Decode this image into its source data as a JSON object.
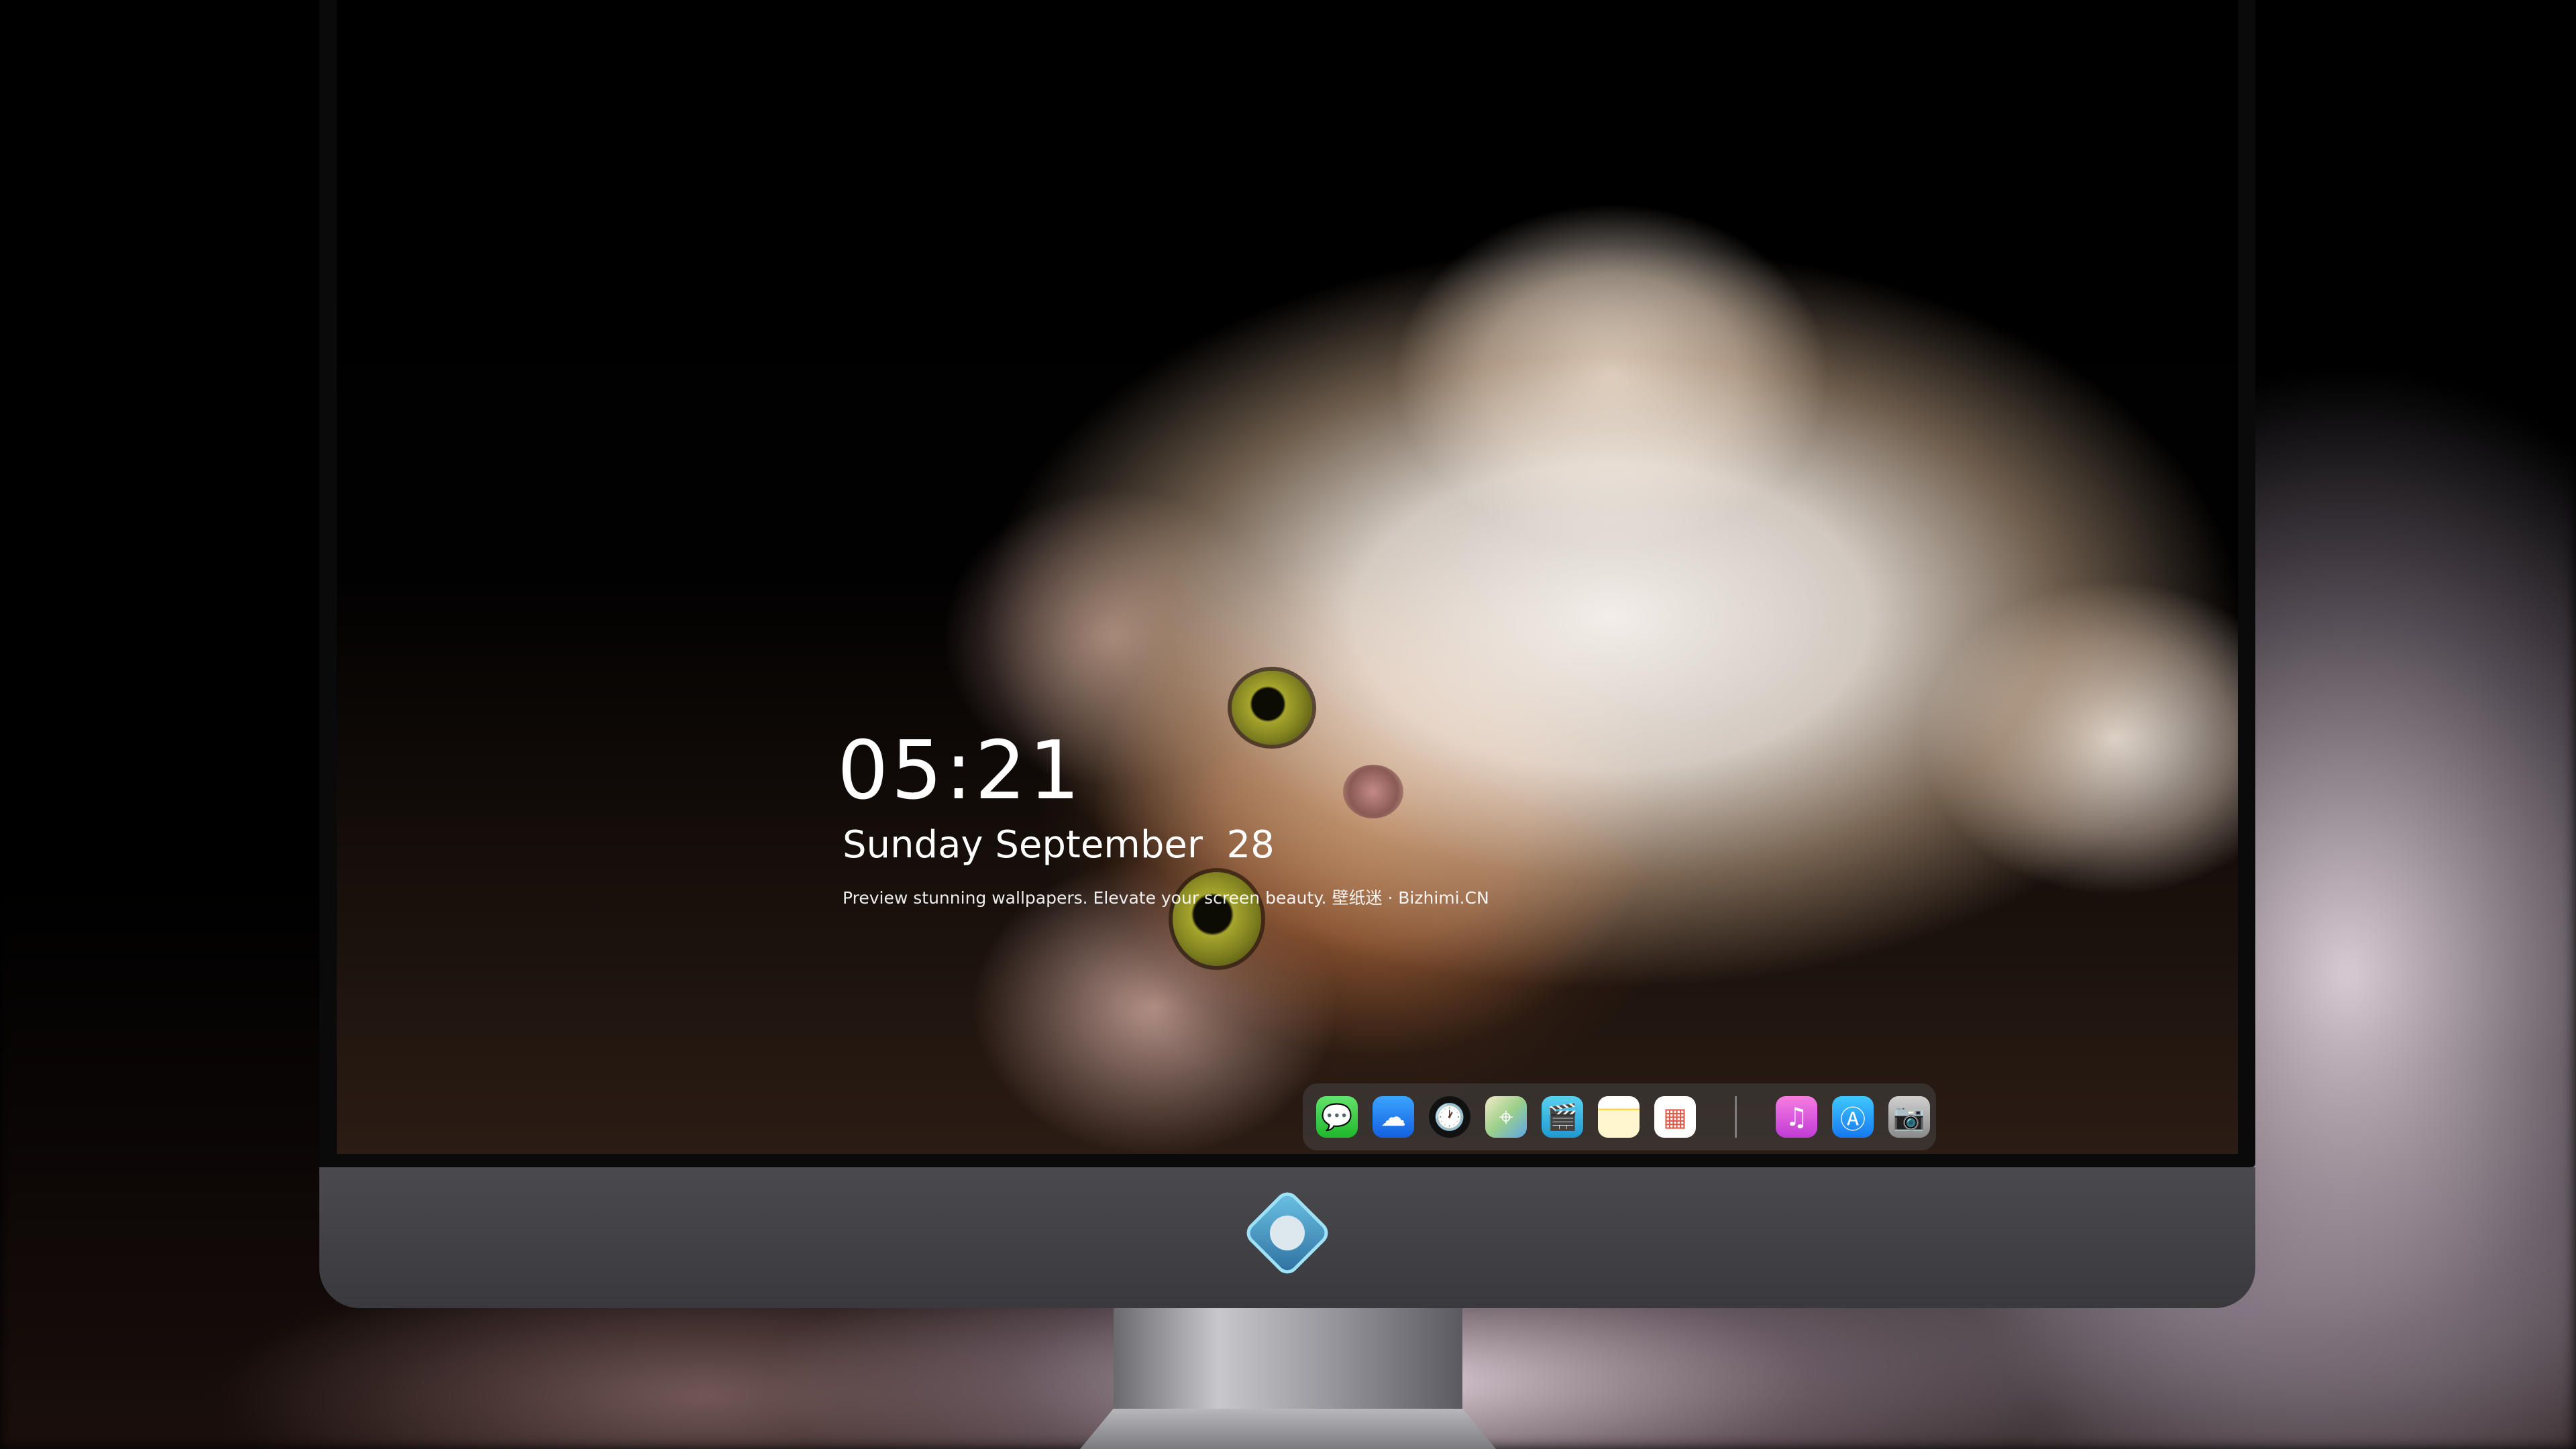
{
  "lockscreen": {
    "time": "05:21",
    "date": "Sunday September  28",
    "tagline": "Preview stunning wallpapers. Elevate your screen beauty. 壁纸迷 · Bizhimi.CN"
  },
  "dock": {
    "apps": [
      {
        "name": "Messages",
        "icon": "messages-icon",
        "glyph": "💬"
      },
      {
        "name": "Weather",
        "icon": "weather-icon",
        "glyph": "☁"
      },
      {
        "name": "Clock",
        "icon": "clock-icon",
        "glyph": "🕐"
      },
      {
        "name": "Maps",
        "icon": "maps-icon",
        "glyph": "⌖"
      },
      {
        "name": "Videos",
        "icon": "clapperboard-icon",
        "glyph": "🎬"
      },
      {
        "name": "Notes",
        "icon": "notes-icon",
        "glyph": ""
      },
      {
        "name": "Photos",
        "icon": "photos-icon",
        "glyph": "▦"
      },
      {
        "name": "Music",
        "icon": "music-icon",
        "glyph": "♫"
      },
      {
        "name": "App Store",
        "icon": "app-store-icon",
        "glyph": "Ⓐ"
      },
      {
        "name": "Camera",
        "icon": "camera-icon",
        "glyph": "📷"
      }
    ]
  },
  "colors": {
    "dock_background": "#464646",
    "monitor_chin": "#4a4a4e",
    "logo_accent": "#6fc7e8"
  }
}
